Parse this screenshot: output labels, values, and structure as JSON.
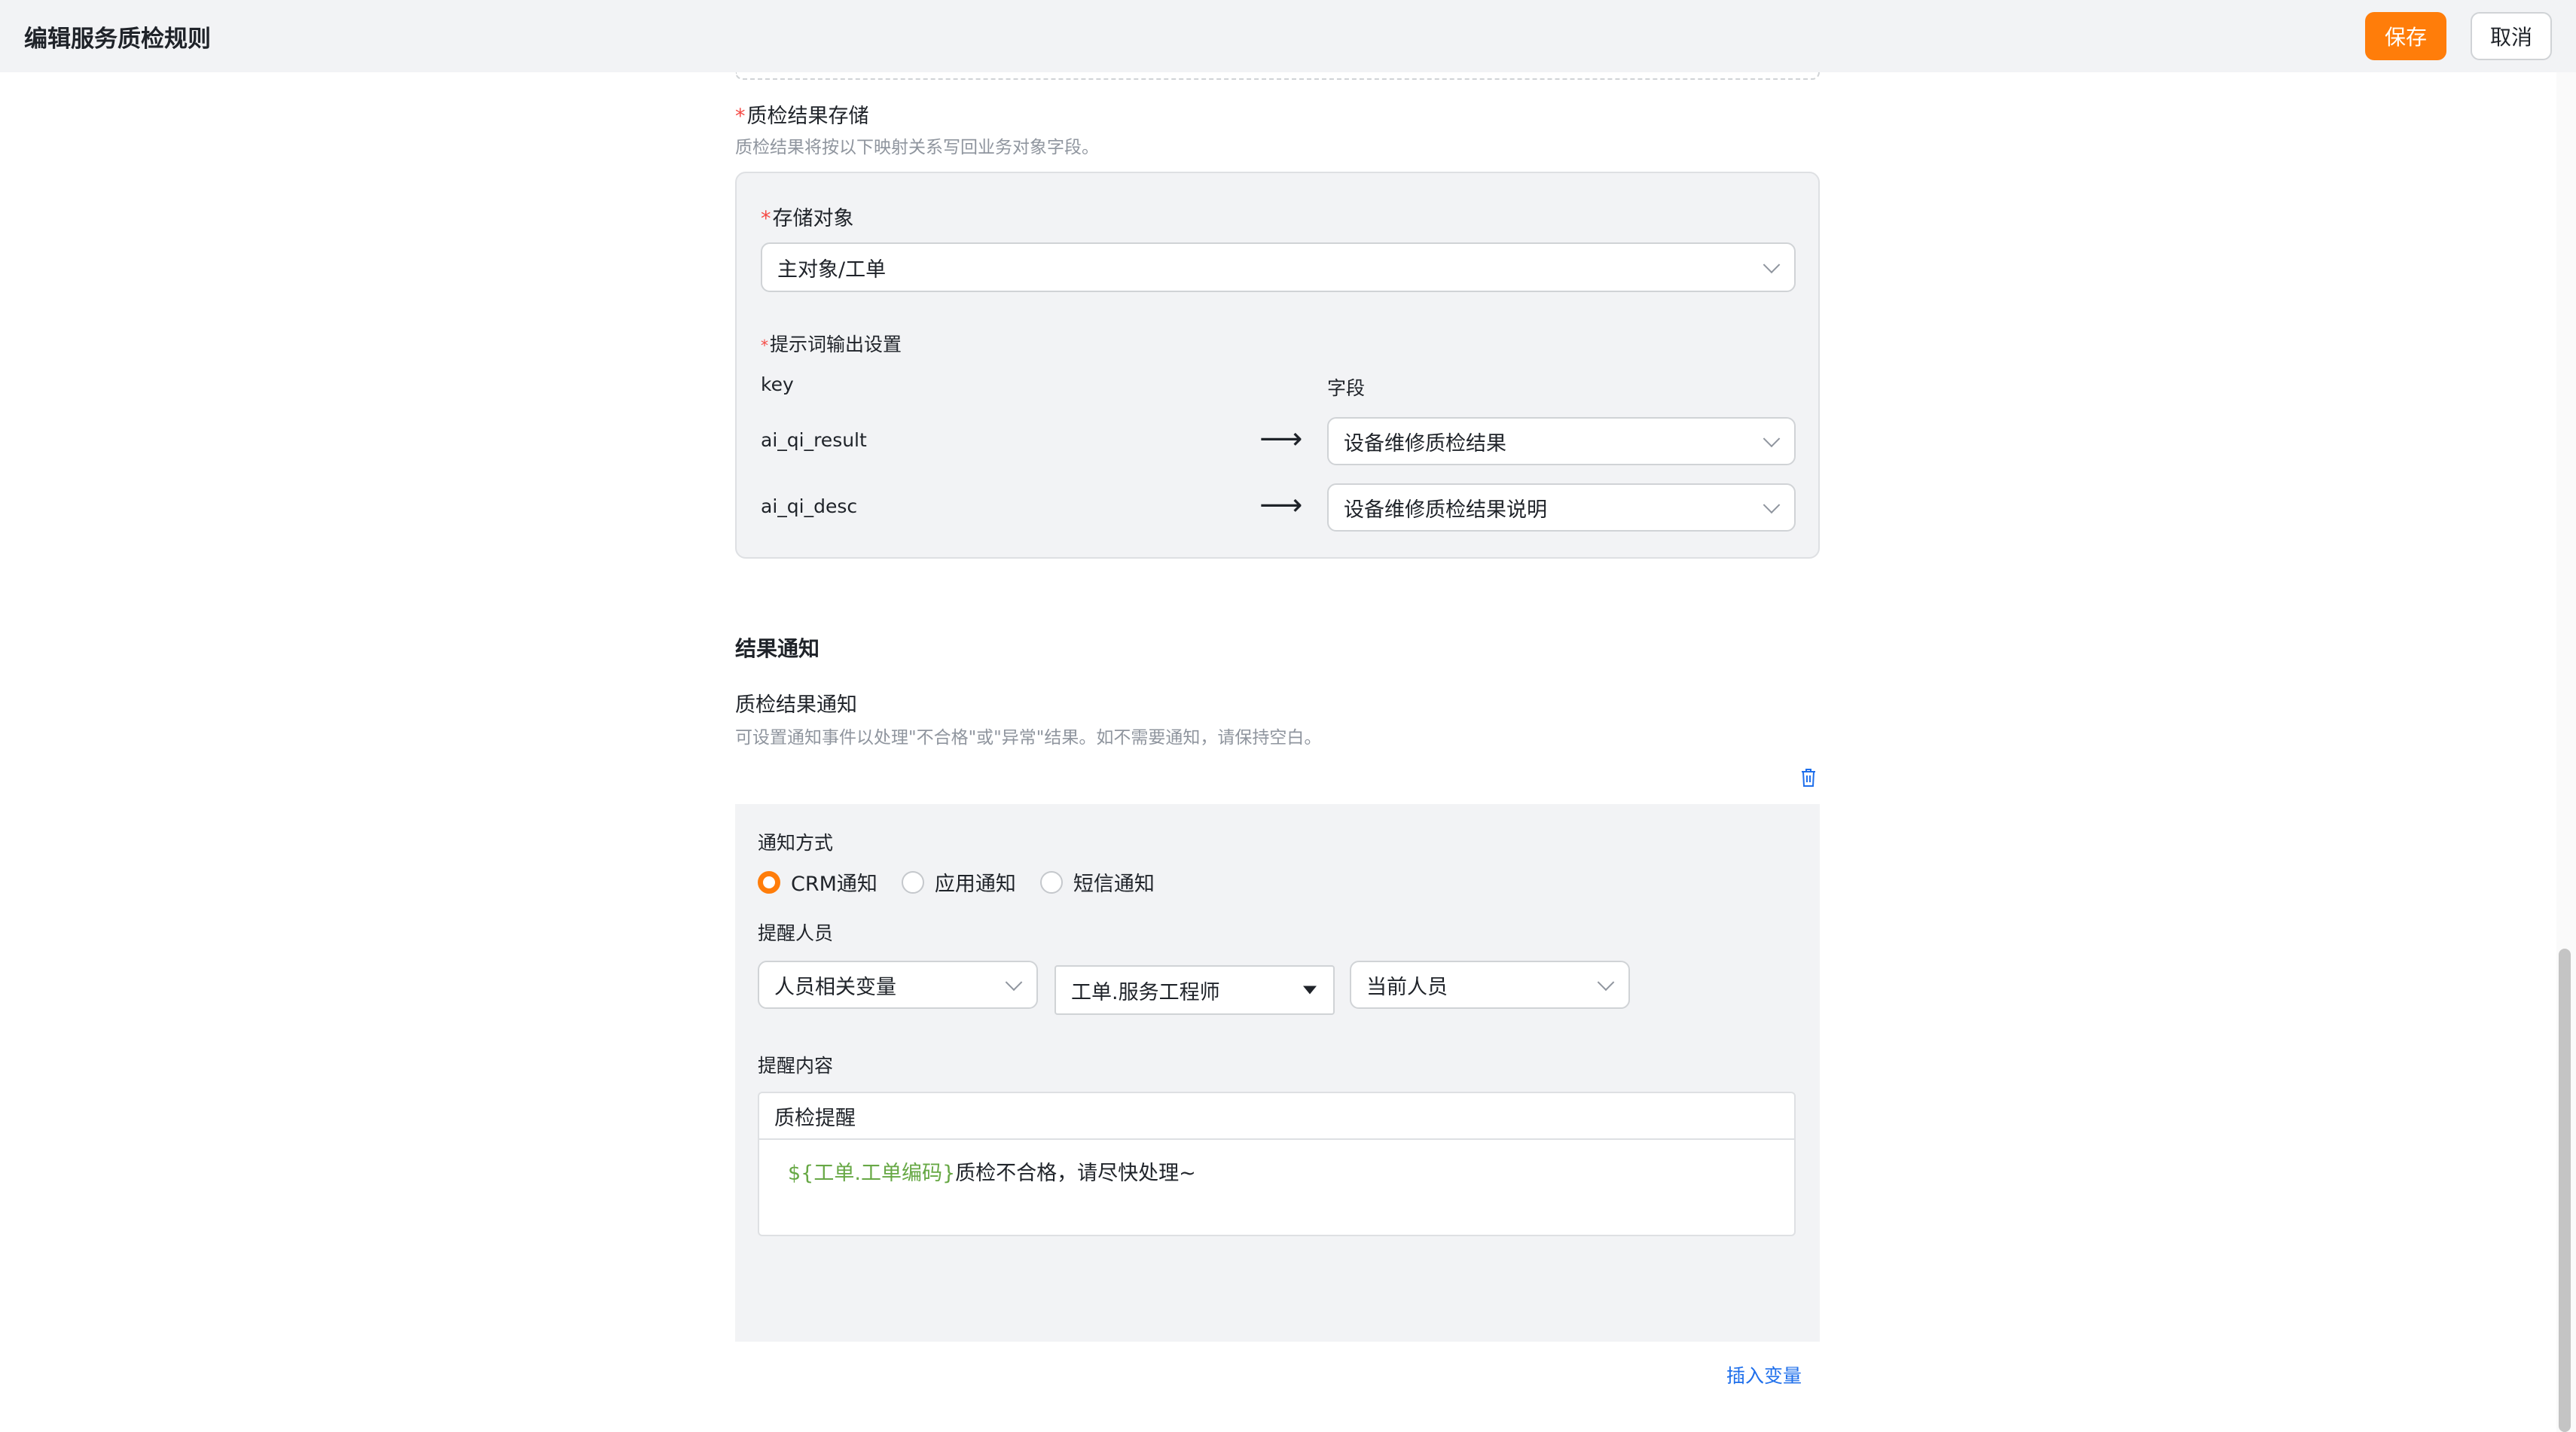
{
  "header": {
    "title": "编辑服务质检规则",
    "save_label": "保存",
    "cancel_label": "取消"
  },
  "storage": {
    "required_mark": "*",
    "label": "质检结果存储",
    "hint": "质检结果将按以下映射关系写回业务对象字段。",
    "object_label": "存储对象",
    "object_value": "主对象/工单",
    "prompt_output_label": "提示词输出设置",
    "key_header": "key",
    "field_header": "字段",
    "arrow": "⟶",
    "mappings": [
      {
        "key": "ai_qi_result",
        "field": "设备维修质检结果"
      },
      {
        "key": "ai_qi_desc",
        "field": "设备维修质检结果说明"
      }
    ]
  },
  "notify": {
    "section_title": "结果通知",
    "label": "质检结果通知",
    "hint": "可设置通知事件以处理\"不合格\"或\"异常\"结果。如不需要通知，请保持空白。",
    "method_label": "通知方式",
    "methods": [
      {
        "label": "CRM通知",
        "checked": true
      },
      {
        "label": "应用通知",
        "checked": false
      },
      {
        "label": "短信通知",
        "checked": false
      }
    ],
    "recipient_label": "提醒人员",
    "recipient_type": "人员相关变量",
    "recipient_field": "工单.服务工程师",
    "recipient_scope": "当前人员",
    "content_label": "提醒内容",
    "content_title": "质检提醒",
    "content_variable": "${工单.工单编码}",
    "content_text": "质检不合格，请尽快处理~",
    "insert_variable": "插入变量"
  },
  "colors": {
    "accent": "#ff7d0a",
    "link": "#1f6feb",
    "variable": "#67a845",
    "required": "#f54a45"
  }
}
